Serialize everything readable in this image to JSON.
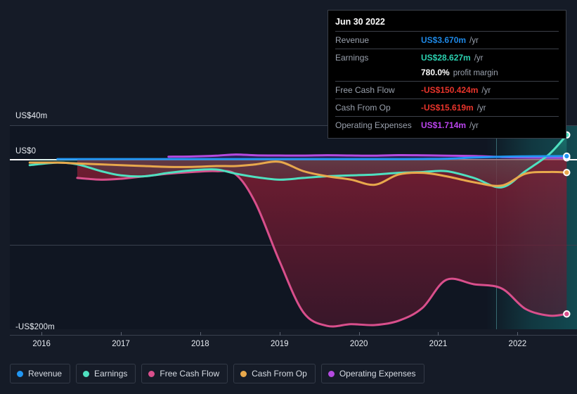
{
  "axes": {
    "y_labels": [
      {
        "text": "US$40m",
        "value": 40
      },
      {
        "text": "US$0",
        "value": 0
      },
      {
        "text": "-US$200m",
        "value": -200
      }
    ],
    "x_labels": [
      "2016",
      "2017",
      "2018",
      "2019",
      "2020",
      "2021",
      "2022"
    ],
    "currency": "US$"
  },
  "tooltip": {
    "date": "Jun 30 2022",
    "rows": [
      {
        "name": "Revenue",
        "value": "US$3.670m",
        "suffix": "/yr",
        "color": "#1e88e5"
      },
      {
        "name": "Earnings",
        "value": "US$28.627m",
        "suffix": "/yr",
        "color": "#2ad1b0"
      },
      {
        "name": "",
        "value": "780.0%",
        "suffix": "profit margin",
        "color": "#ffffff"
      },
      {
        "name": "Free Cash Flow",
        "value": "-US$150.424m",
        "suffix": "/yr",
        "color": "#e8342b"
      },
      {
        "name": "Cash From Op",
        "value": "-US$15.619m",
        "suffix": "/yr",
        "color": "#e8342b"
      },
      {
        "name": "Operating Expenses",
        "value": "US$1.714m",
        "suffix": "/yr",
        "color": "#bb44ee"
      }
    ]
  },
  "legend": {
    "items": [
      {
        "label": "Revenue",
        "color": "#2196f3"
      },
      {
        "label": "Earnings",
        "color": "#4fe0c0"
      },
      {
        "label": "Free Cash Flow",
        "color": "#d94f8c"
      },
      {
        "label": "Cash From Op",
        "color": "#e8a84c"
      },
      {
        "label": "Operating Expenses",
        "color": "#b44ae0"
      }
    ]
  },
  "chart_data": {
    "type": "line",
    "title": "",
    "xlabel": "",
    "ylabel": "US$",
    "ylim": [
      -200,
      40
    ],
    "xlim": [
      2015.6,
      2022.75
    ],
    "grid": true,
    "legend_position": "bottom",
    "forecast_start": 2021.45,
    "x": [
      2015.85,
      2016.2,
      2016.45,
      2016.75,
      2017.0,
      2017.3,
      2017.6,
      2017.9,
      2018.2,
      2018.45,
      2018.7,
      2019.0,
      2019.3,
      2019.6,
      2019.9,
      2020.2,
      2020.5,
      2020.8,
      2021.1,
      2021.45,
      2021.8,
      2022.1,
      2022.4,
      2022.62
    ],
    "series": [
      {
        "name": "Revenue",
        "color": "#2196f3",
        "start_x": 2016.15,
        "values": [
          null,
          0.2,
          0.2,
          0.2,
          0.2,
          0.2,
          0.2,
          0.2,
          0.2,
          0.2,
          0.2,
          0.2,
          0.2,
          0.2,
          0.2,
          0.2,
          0.2,
          0.3,
          0.6,
          2.0,
          3.0,
          3.4,
          3.6,
          3.67
        ]
      },
      {
        "name": "Earnings",
        "color": "#4fe0c0",
        "start_x": 2015.85,
        "values": [
          -7,
          -4,
          -6,
          -14,
          -19,
          -20,
          -16,
          -13,
          -12,
          -17,
          -21,
          -24,
          -22,
          -20,
          -19,
          -18,
          -16,
          -15,
          -14,
          -22,
          -33,
          -14,
          6,
          28.6
        ]
      },
      {
        "name": "Free Cash Flow",
        "color": "#d94f8c",
        "start_x": 2016.45,
        "values": [
          null,
          null,
          -22,
          -24,
          -23,
          -20,
          -17,
          -15,
          -14,
          -18,
          -52,
          -120,
          -180,
          -196,
          -194,
          -195,
          -190,
          -175,
          -142,
          -147,
          -152,
          -176,
          -184,
          -182
        ]
      },
      {
        "name": "Cash From Op",
        "color": "#e8a84c",
        "start_x": 2015.85,
        "values": [
          -4,
          -4,
          -5,
          -6,
          -7,
          -8,
          -9,
          -9,
          -8,
          -8,
          -6,
          -3,
          -14,
          -20,
          -24,
          -30,
          -18,
          -16,
          -20,
          -27,
          -31,
          -17,
          -15,
          -15.6
        ]
      },
      {
        "name": "Operating Expenses",
        "color": "#b44ae0",
        "start_x": 2017.6,
        "values": [
          null,
          null,
          null,
          null,
          null,
          null,
          3.0,
          3.3,
          4.2,
          5.6,
          4.6,
          4.4,
          4.3,
          4.7,
          4.4,
          4.2,
          4.8,
          4.6,
          4.2,
          3.8,
          2.6,
          2.0,
          1.8,
          1.71
        ]
      }
    ]
  }
}
